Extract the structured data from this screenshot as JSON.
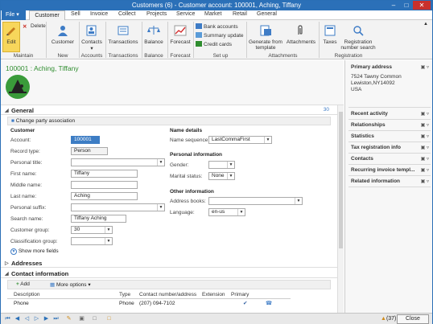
{
  "window": {
    "title": "Customers (6) - Customer account: 100001, Aching, Tiffany"
  },
  "menu": {
    "file": "File",
    "tabs": [
      "Customer",
      "Sell",
      "Invoice",
      "Collect",
      "Projects",
      "Service",
      "Market",
      "Retail",
      "General"
    ]
  },
  "ribbon": {
    "edit": "Edit",
    "delete": "Delete",
    "maintain": "Maintain",
    "customer": "Customer",
    "new": "New",
    "contacts": "Contacts",
    "accounts": "Accounts",
    "transactions": "Transactions",
    "transactions_group": "Transactions",
    "balance": "Balance",
    "forecast": "Forecast",
    "balance_group": "Balance",
    "forecast_group": "Forecast",
    "bank_accounts": "Bank accounts",
    "summary_update": "Summary update",
    "credit_cards": "Credit cards",
    "setup": "Set up",
    "generate_template": "Generate from template",
    "attachments": "Attachments",
    "attachments_group": "Attachments",
    "taxes": "Taxes",
    "registration_search": "Registration number search",
    "registration_group": "Registration"
  },
  "header": {
    "name": "100001 : Aching, Tiffany"
  },
  "general": {
    "title": "General",
    "count": "30",
    "change_party": "Change party association",
    "customer_hd": "Customer",
    "account_label": "Account:",
    "account_value": "100001",
    "record_type_label": "Record type:",
    "record_type_value": "Person",
    "personal_title_label": "Personal title:",
    "first_name_label": "First name:",
    "first_name_value": "Tiffany",
    "middle_name_label": "Middle name:",
    "last_name_label": "Last name:",
    "last_name_value": "Aching",
    "personal_suffix_label": "Personal suffix:",
    "search_name_label": "Search name:",
    "search_name_value": "Tiffany Aching",
    "customer_group_label": "Customer group:",
    "customer_group_value": "30",
    "classification_group_label": "Classification group:",
    "show_more": "Show more fields",
    "name_details_hd": "Name details",
    "name_sequence_label": "Name sequence:",
    "name_sequence_value": "LastCommaFirst",
    "personal_info_hd": "Personal information",
    "gender_label": "Gender:",
    "marital_label": "Marital status:",
    "marital_value": "None",
    "other_info_hd": "Other information",
    "address_books_label": "Address books:",
    "language_label": "Language:",
    "language_value": "en-us"
  },
  "addresses": {
    "title": "Addresses"
  },
  "contact": {
    "title": "Contact information",
    "add": "Add",
    "more_options": "More options",
    "columns": [
      "Description",
      "Type",
      "Contact number/address",
      "Extension",
      "Primary"
    ],
    "rows": [
      {
        "description": "Phone",
        "type": "Phone",
        "contact": "(207) 094-7102",
        "extension": "",
        "primary": "✔"
      }
    ]
  },
  "right": {
    "primary_address": "Primary address",
    "addr_line1": "7524 Tawny Common",
    "addr_line2": "Lewiston,NY14092",
    "addr_line3": "USA",
    "items": [
      "Recent activity",
      "Relationships",
      "Statistics",
      "Tax registration info",
      "Contacts",
      "Recurring invoice templ...",
      "Related information"
    ]
  },
  "status": {
    "count": "(37)",
    "close": "Close"
  }
}
